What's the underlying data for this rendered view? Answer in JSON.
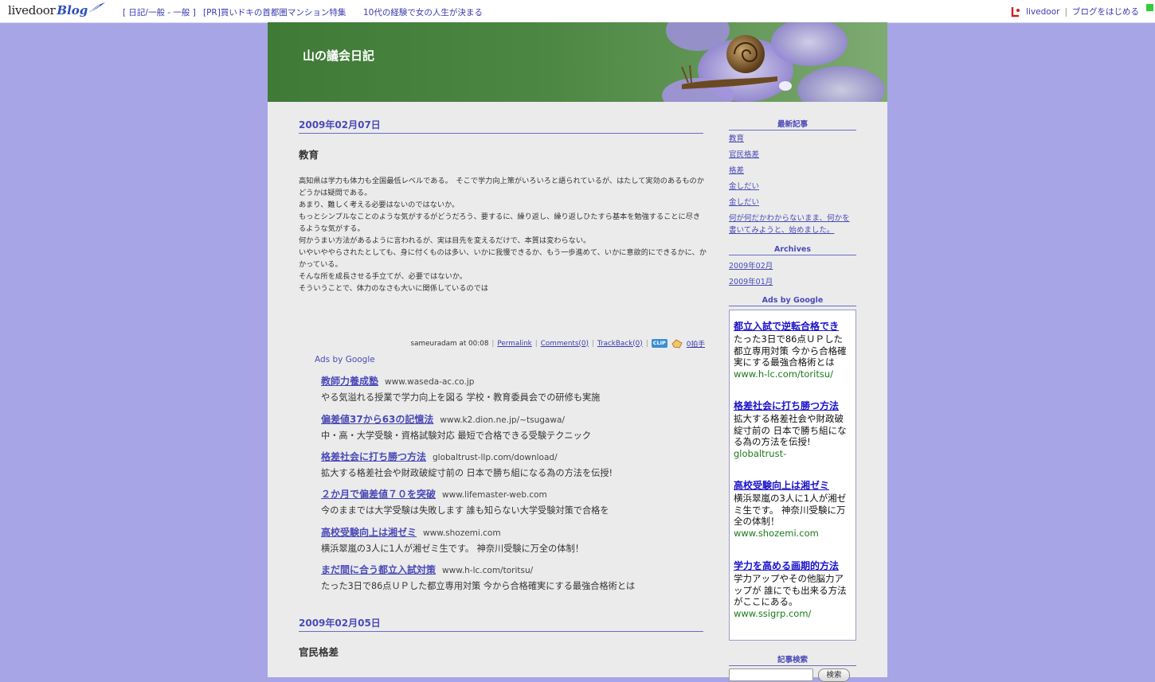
{
  "topbar": {
    "logo_text": "livedoor",
    "logo_blog": "Blog",
    "links": [
      "[ 日記/一般 - 一般 ]",
      "[PR]買いドキの首都圏マンション特集",
      "10代の経験で女の人生が決まる"
    ],
    "livedoor_link": "livedoor",
    "start_blog": "ブログをはじめる",
    "separator": "|"
  },
  "blog": {
    "title": "山の議会日記"
  },
  "entries": [
    {
      "date": "2009年02月07日",
      "title": "教育",
      "body": [
        "高知県は学力も体力も全国最低レベルである。　そこで学力向上策がいろいろと語られているが、はたして実効のあるものかどうかは疑問である。",
        "あまり、難しく考える必要はないのではないか。",
        "もっとシンプルなことのような気がするがどうだろう、要するに、繰り返し、繰り返しひたすら基本を勉強することに尽きるような気がする。",
        "何かうまい方法があるように言われるが、実は目先を変えるだけで、本質は変わらない。",
        "いやいややらされたとしても、身に付くものは多い、いかに我慢できるか、もう一歩進めて、いかに意欲的にできるかに、かかっている。",
        "そんな所を成長させる手立てが、必要ではないか。",
        "そういうことで、体力のなさも大いに関係しているのでは"
      ],
      "footer": {
        "author_time": "sameuradam at 00:08",
        "permalink": "Permalink",
        "comments": "Comments(0)",
        "trackback": "TrackBack(0)",
        "clip": "CLIP",
        "hakushu": "0拍手"
      }
    },
    {
      "date": "2009年02月05日",
      "title": "官民格差"
    }
  ],
  "main_ads": {
    "label": "Ads by Google",
    "items": [
      {
        "title": "教師力養成塾",
        "url": "www.waseda-ac.co.jp",
        "desc": "やる気溢れる授業で学力向上を図る 学校・教育委員会での研修も実施"
      },
      {
        "title": "偏差値37から63の記憶法",
        "url": "www.k2.dion.ne.jp/~tsugawa/",
        "desc": "中・高・大学受験・資格試験対応 最短で合格できる受験テクニック"
      },
      {
        "title": "格差社会に打ち勝つ方法",
        "url": "globaltrust-llp.com/download/",
        "desc": "拡大する格差社会や財政破綻寸前の 日本で勝ち組になる為の方法を伝授!"
      },
      {
        "title": "２か月で偏差値７０を突破",
        "url": "www.lifemaster-web.com",
        "desc": "今のままでは大学受験は失敗します 誰も知らない大学受験対策で合格を"
      },
      {
        "title": "高校受験向上は湘ゼミ",
        "url": "www.shozemi.com",
        "desc": "横浜翠嵐の3人に1人が湘ゼミ生です。 神奈川受験に万全の体制！"
      },
      {
        "title": "まだ間に合う都立入試対策",
        "url": "www.h-lc.com/toritsu/",
        "desc": "たった3日で86点ＵＰした都立専用対策 今から合格確実にする最強合格術とは"
      }
    ]
  },
  "sidebar": {
    "recent_heading": "最新記事",
    "recent": [
      "教育",
      "官民格差",
      "格差",
      "金しだい",
      "金しだい",
      "何が何だかわからないまま、何かを書いてみようと、始めました。"
    ],
    "archives_heading": "Archives",
    "archives": [
      "2009年02月",
      "2009年01月"
    ],
    "ads_heading": "Ads by Google",
    "ads": [
      {
        "title": "都立入試で逆転合格でき",
        "desc": "たった3日で86点ＵＰした都立専用対策 今から合格確実にする最強合格術とは",
        "url": "www.h-lc.com/toritsu/"
      },
      {
        "title": "格差社会に打ち勝つ方法",
        "desc": "拡大する格差社会や財政破綻寸前の 日本で勝ち組になる為の方法を伝授!",
        "url": "globaltrust-"
      },
      {
        "title": "高校受験向上は湘ゼミ",
        "desc": "横浜翠嵐の3人に1人が湘ゼミ生です。 神奈川受験に万全の体制！",
        "url": "www.shozemi.com"
      },
      {
        "title": "学力を高める画期的方法",
        "desc": "学力アップやその他脳力アップが 誰にでも出来る方法がここにある。",
        "url": "www.ssigrp.com/"
      }
    ],
    "search_heading": "記事検索",
    "search_button": "検索"
  },
  "colors": {
    "background": "#a7a5e6",
    "content_bg": "#ebebeb",
    "link": "#4a4ab8",
    "banner_green": "#4d8744"
  }
}
